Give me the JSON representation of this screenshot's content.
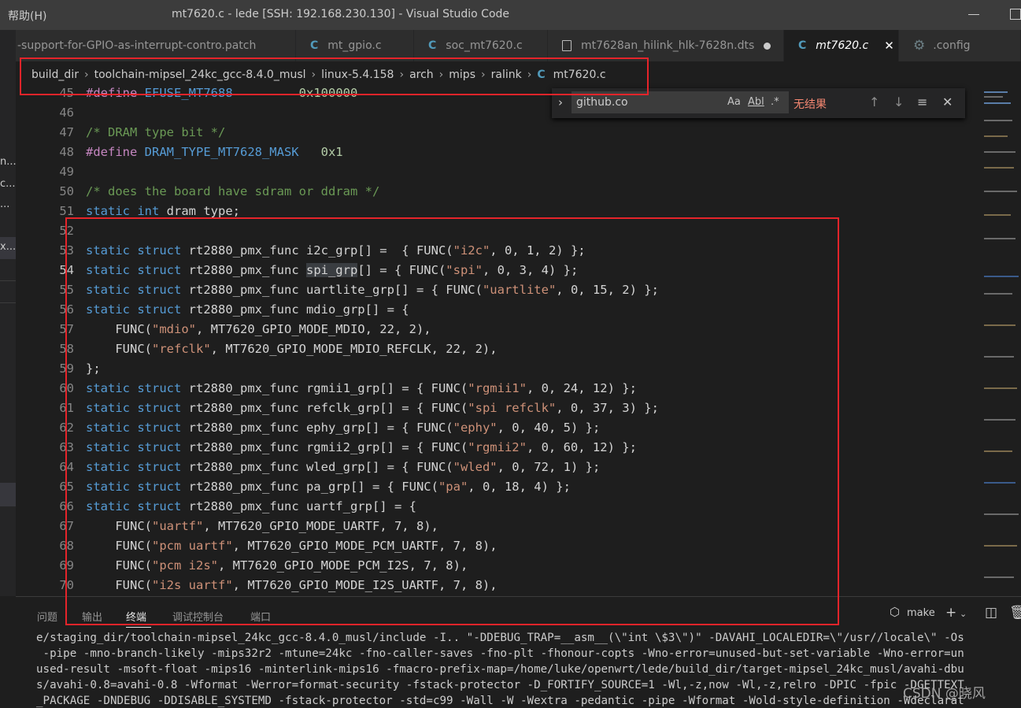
{
  "window": {
    "menu_help": "帮助(H)",
    "title": "mt7620.c - lede [SSH: 192.168.230.130] - Visual Studio Code"
  },
  "activity": [
    "n...",
    "c...",
    "..."
  ],
  "activity_selected": "x...",
  "tabs": [
    {
      "label": "-support-for-GPIO-as-interrupt-contro.patch",
      "icon": "none"
    },
    {
      "label": "mt_gpio.c",
      "icon": "c-icon"
    },
    {
      "label": "soc_mt7620.c",
      "icon": "c-icon"
    },
    {
      "label": "mt7628an_hilink_hlk-7628n.dts",
      "icon": "file-icon",
      "modified": true
    },
    {
      "label": "mt7620.c",
      "icon": "c-icon",
      "active": true
    },
    {
      "label": ".config",
      "icon": "gear-icon"
    }
  ],
  "breadcrumb": [
    "build_dir",
    "toolchain-mipsel_24kc_gcc-8.4.0_musl",
    "linux-5.4.158",
    "arch",
    "mips",
    "ralink",
    "mt7620.c"
  ],
  "find": {
    "value": "github.co",
    "opt_case": "Aa",
    "opt_word": "Abl",
    "opt_regex": ".*",
    "result": "无结果"
  },
  "code": {
    "line_numbers": [
      "45",
      "46",
      "47",
      "48",
      "49",
      "50",
      "51",
      "52",
      "53",
      "54",
      "55",
      "56",
      "57",
      "58",
      "59",
      "60",
      "61",
      "62",
      "63",
      "64",
      "65",
      "66",
      "67",
      "68",
      "69",
      "70"
    ],
    "active_line": "54",
    "lines": {
      "l45_kw": "#define",
      "l45_macro": "EFUSE_MT7688",
      "l45_value": "0x100000",
      "l47": "/* DRAM type bit */",
      "l48_kw": "#define",
      "l48_macro": "DRAM_TYPE_MT7628_MASK",
      "l48_value": "0x1",
      "l50": "/* does the board have sdram or ddram */",
      "l51_kw": "static int",
      "l51_rest": " dram_type;",
      "l53": [
        "rt2880_pmx_func i2c_grp[] =  { FUNC(",
        "\"i2c\"",
        ", 0, 1, 2) };"
      ],
      "l54": [
        "rt2880_pmx_func ",
        "spi_grp",
        "[] = { FUNC(",
        "\"spi\"",
        ", 0, 3, 4) };"
      ],
      "l55": [
        "rt2880_pmx_func uartlite_grp[] = { FUNC(",
        "\"uartlite\"",
        ", 0, 15, 2) };"
      ],
      "l56": "rt2880_pmx_func mdio_grp[] = {",
      "l57": [
        "FUNC(",
        "\"mdio\"",
        ", MT7620_GPIO_MODE_MDIO, 22, 2),"
      ],
      "l58": [
        "FUNC(",
        "\"refclk\"",
        ", MT7620_GPIO_MODE_MDIO_REFCLK, 22, 2),"
      ],
      "l59": "};",
      "l60": [
        "rt2880_pmx_func rgmii1_grp[] = { FUNC(",
        "\"rgmii1\"",
        ", 0, 24, 12) };"
      ],
      "l61": [
        "rt2880_pmx_func refclk_grp[] = { FUNC(",
        "\"spi refclk\"",
        ", 0, 37, 3) };"
      ],
      "l62": [
        "rt2880_pmx_func ephy_grp[] = { FUNC(",
        "\"ephy\"",
        ", 0, 40, 5) };"
      ],
      "l63": [
        "rt2880_pmx_func rgmii2_grp[] = { FUNC(",
        "\"rgmii2\"",
        ", 0, 60, 12) };"
      ],
      "l64": [
        "rt2880_pmx_func wled_grp[] = { FUNC(",
        "\"wled\"",
        ", 0, 72, 1) };"
      ],
      "l65": [
        "rt2880_pmx_func pa_grp[] = { FUNC(",
        "\"pa\"",
        ", 0, 18, 4) };"
      ],
      "l66": "rt2880_pmx_func uartf_grp[] = {",
      "l67": [
        "FUNC(",
        "\"uartf\"",
        ", MT7620_GPIO_MODE_UARTF, 7, 8),"
      ],
      "l68": [
        "FUNC(",
        "\"pcm uartf\"",
        ", MT7620_GPIO_MODE_PCM_UARTF, 7, 8),"
      ],
      "l69": [
        "FUNC(",
        "\"pcm i2s\"",
        ", MT7620_GPIO_MODE_PCM_I2S, 7, 8),"
      ],
      "l70": [
        "FUNC(",
        "\"i2s uartf\"",
        ", MT7620_GPIO_MODE_I2S_UARTF, 7, 8),"
      ],
      "static_struct": "static struct"
    }
  },
  "panel": {
    "tabs": [
      "问题",
      "输出",
      "终端",
      "调试控制台",
      "端口"
    ],
    "active_tab": "终端",
    "terminal_name": "make",
    "terminal_lines": [
      "e/staging_dir/toolchain-mipsel_24kc_gcc-8.4.0_musl/include -I.. \"-DDEBUG_TRAP=__asm__(\\\"int \\$3\\\")\" -DAVAHI_LOCALEDIR=\\\"/usr//locale\\\" -Os",
      " -pipe -mno-branch-likely -mips32r2 -mtune=24kc -fno-caller-saves -fno-plt -fhonour-copts -Wno-error=unused-but-set-variable -Wno-error=un",
      "used-result -msoft-float -mips16 -minterlink-mips16 -fmacro-prefix-map=/home/luke/openwrt/lede/build_dir/target-mipsel_24kc_musl/avahi-dbu",
      "s/avahi-0.8=avahi-0.8 -Wformat -Werror=format-security -fstack-protector -D_FORTIFY_SOURCE=1 -Wl,-z,now -Wl,-z,relro -DPIC -fpic -DGETTEXT",
      "_PACKAGE -DNDEBUG -DDISABLE_SYSTEMD -fstack-protector -std=c99 -Wall -W -Wextra -pedantic -pipe -Wformat -Wold-style-definition -Wdeclarat"
    ]
  },
  "watermark": "CSDN @晓风",
  "colors": {
    "annotation_red": "#e5242a",
    "keyword": "#569cd6",
    "string": "#ce9178",
    "number": "#b5cea8",
    "comment": "#6a9955"
  }
}
